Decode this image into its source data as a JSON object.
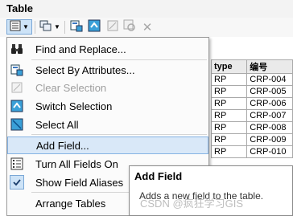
{
  "window": {
    "title": "Table"
  },
  "toolbar": {
    "buttons": [
      {
        "name": "table-options-icon",
        "active": true
      },
      {
        "name": "related-tables-icon"
      },
      {
        "name": "select-by-attributes-icon"
      },
      {
        "name": "switch-selection-icon"
      },
      {
        "name": "clear-selection-icon"
      },
      {
        "name": "zoom-to-selected-icon"
      },
      {
        "name": "delete-selected-icon"
      }
    ]
  },
  "menu": {
    "items": [
      {
        "label": "Find and Replace...",
        "icon": "binoculars-icon",
        "disabled": false
      },
      {
        "label": "Select By Attributes...",
        "icon": "select-by-attributes-icon",
        "disabled": false
      },
      {
        "label": "Clear Selection",
        "icon": "clear-selection-icon",
        "disabled": true
      },
      {
        "label": "Switch Selection",
        "icon": "switch-selection-icon",
        "disabled": false
      },
      {
        "label": "Select All",
        "icon": "select-all-icon",
        "disabled": false
      },
      {
        "label": "Add Field...",
        "icon": "",
        "disabled": false,
        "highlighted": true
      },
      {
        "label": "Turn All Fields On",
        "icon": "fields-list-icon",
        "disabled": false
      },
      {
        "label": "Show Field Aliases",
        "icon": "checkmark-icon",
        "disabled": false,
        "checked": true
      },
      {
        "label": "Arrange Tables",
        "icon": "",
        "disabled": false
      }
    ]
  },
  "table": {
    "headers": [
      "type",
      "编号"
    ],
    "rows": [
      [
        "RP",
        "CRP-004"
      ],
      [
        "RP",
        "CRP-005"
      ],
      [
        "RP",
        "CRP-006"
      ],
      [
        "RP",
        "CRP-007"
      ],
      [
        "RP",
        "CRP-008"
      ],
      [
        "RP",
        "CRP-009"
      ],
      [
        "RP",
        "CRP-010"
      ]
    ]
  },
  "tooltip": {
    "title": "Add Field",
    "description": "Adds a new field to the table."
  },
  "watermark": "CSDN @疯狂学习GIS",
  "colors": {
    "highlight_bg": "#d9e8f8",
    "highlight_border": "#86b3e3",
    "disabled_text": "#9e9e9e"
  }
}
